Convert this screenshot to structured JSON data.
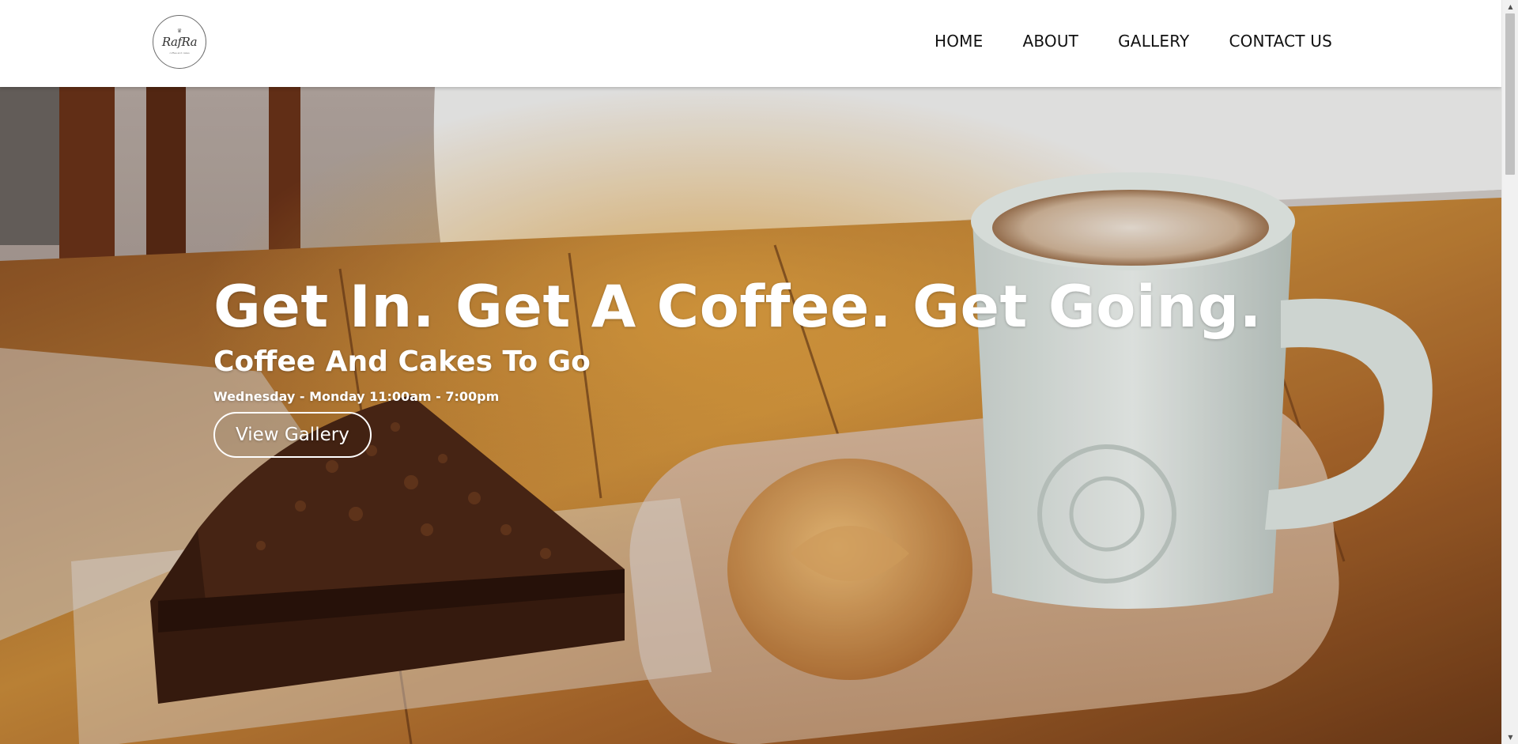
{
  "header": {
    "logo_text": "RafRa",
    "logo_subtext": "coffee and cakes",
    "nav": [
      {
        "label": "HOME"
      },
      {
        "label": "ABOUT"
      },
      {
        "label": "GALLERY"
      },
      {
        "label": "CONTACT US"
      }
    ]
  },
  "hero": {
    "title": "Get In. Get A Coffee. Get Going.",
    "subtitle": "Coffee And Cakes To Go",
    "hours": "Wednesday - Monday 11:00am - 7:00pm",
    "button_label": "View Gallery"
  },
  "colors": {
    "header_bg": "#ffffff",
    "nav_text": "#111111",
    "hero_text": "#ffffff",
    "table_wood": "#a8642a",
    "scrollbar_track": "#f1f1f1",
    "scrollbar_thumb": "#c1c1c1"
  },
  "icons": {
    "scroll_up": "chevron-up-icon",
    "scroll_down": "chevron-down-icon"
  }
}
